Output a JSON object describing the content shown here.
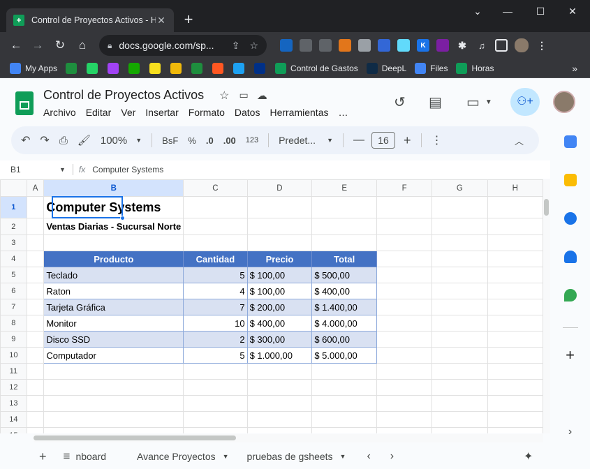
{
  "browser": {
    "tab_title": "Control de Proyectos Activos - H",
    "tab_close": "✕",
    "new_tab": "+",
    "window_controls": [
      "⌄",
      "—",
      "☐",
      "✕"
    ],
    "url": "docs.google.com/sp...",
    "bookmarks": [
      {
        "label": "My Apps",
        "color": "#4285f4"
      },
      {
        "label": "",
        "color": "#1e8e3e"
      },
      {
        "label": "",
        "color": "#25d366"
      },
      {
        "label": "",
        "color": "#a142f4"
      },
      {
        "label": "",
        "color": "#14a800"
      },
      {
        "label": "",
        "color": "#f7df1e"
      },
      {
        "label": "",
        "color": "#f0b90b"
      },
      {
        "label": "",
        "color": "#1e8e3e"
      },
      {
        "label": "",
        "color": "#ff5722"
      },
      {
        "label": "",
        "color": "#1da1f2"
      },
      {
        "label": "",
        "color": "#003087"
      },
      {
        "label": "Control de Gastos",
        "color": "#0f9d58"
      },
      {
        "label": "DeepL",
        "color": "#0f2b46"
      },
      {
        "label": "Files",
        "color": "#4285f4"
      },
      {
        "label": "Horas",
        "color": "#0f9d58"
      }
    ],
    "more_bookmarks": "»"
  },
  "sheets": {
    "doc_title": "Control de Proyectos Activos",
    "menus": [
      "Archivo",
      "Editar",
      "Ver",
      "Insertar",
      "Formato",
      "Datos",
      "Herramientas",
      "…"
    ],
    "toolbar": {
      "zoom": "100%",
      "currency": "BsF",
      "percent": "%",
      "dec_decrease": ".0",
      "dec_increase": ".00",
      "number_format": "123",
      "font": "Predet...",
      "font_size": "16"
    },
    "name_box": "B1",
    "formula": "Computer Systems",
    "columns": [
      "A",
      "B",
      "C",
      "D",
      "E",
      "F",
      "G",
      "H"
    ],
    "rows": [
      "1",
      "2",
      "3",
      "4",
      "5",
      "6",
      "7",
      "8",
      "9",
      "10",
      "11",
      "12",
      "13",
      "14",
      "15"
    ],
    "title_cell": "Computer Systems",
    "subtitle_cell": "Ventas Diarias - Sucursal Norte",
    "table": {
      "headers": [
        "Producto",
        "Cantidad",
        "Precio",
        "Total"
      ],
      "rows": [
        [
          "Teclado",
          "5",
          "$ 100,00",
          "$ 500,00"
        ],
        [
          "Raton",
          "4",
          "$ 100,00",
          "$ 400,00"
        ],
        [
          "Tarjeta Gráfica",
          "7",
          "$ 200,00",
          "$ 1.400,00"
        ],
        [
          "Monitor",
          "10",
          "$ 400,00",
          "$ 4.000,00"
        ],
        [
          "Disco SSD",
          "2",
          "$ 300,00",
          "$ 600,00"
        ],
        [
          "Computador",
          "5",
          "$ 1.000,00",
          "$ 5.000,00"
        ]
      ]
    },
    "sheet_tabs": [
      "nboard",
      "Avance Proyectos",
      "pruebas de gsheets"
    ]
  }
}
